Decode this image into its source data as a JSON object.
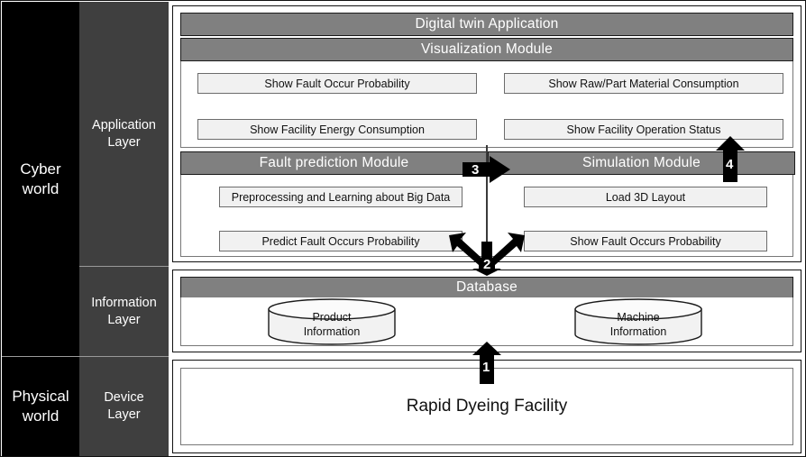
{
  "worlds": [
    {
      "label": "Cyber\nworld"
    },
    {
      "label": "Physical\nworld"
    }
  ],
  "layers": [
    {
      "label": "Application\nLayer"
    },
    {
      "label": "Information\nLayer"
    },
    {
      "label": "Device\nLayer"
    }
  ],
  "application": {
    "app_title": "Digital twin Application",
    "visualization_title": "Visualization Module",
    "visualization_items": [
      "Show Fault Occur Probability",
      "Show Raw/Part Material Consumption",
      "Show Facility Energy Consumption",
      "Show Facility Operation Status"
    ],
    "fault_module_title": "Fault prediction Module",
    "simulation_module_title": "Simulation Module",
    "fault_module_items": [
      "Preprocessing and Learning about Big Data",
      "Predict Fault Occurs Probability"
    ],
    "simulation_module_items": [
      "Load 3D Layout",
      "Show Fault Occurs Probability"
    ]
  },
  "information": {
    "database_title": "Database",
    "stores": [
      {
        "line1": "Product",
        "line2": "Information"
      },
      {
        "line1": "Machine",
        "line2": "Information"
      }
    ]
  },
  "device": {
    "facility_label": "Rapid Dyeing Facility"
  },
  "arrows": [
    {
      "id": "1",
      "label": "1",
      "direction": "up",
      "description": "device-layer-to-information-layer"
    },
    {
      "id": "2",
      "label": "2",
      "direction": "three-way",
      "description": "modules-to-database"
    },
    {
      "id": "3",
      "label": "3",
      "direction": "right",
      "description": "fault-prediction-to-simulation"
    },
    {
      "id": "4",
      "label": "4",
      "direction": "up",
      "description": "simulation-to-visualization"
    }
  ],
  "colors": {
    "world_bg": "#000000",
    "layer_bg": "#3f3f3f",
    "bar_gray": "#808080",
    "item_gray": "#f1f1f1",
    "arrow_black": "#000000",
    "panel_border": "#111111"
  }
}
